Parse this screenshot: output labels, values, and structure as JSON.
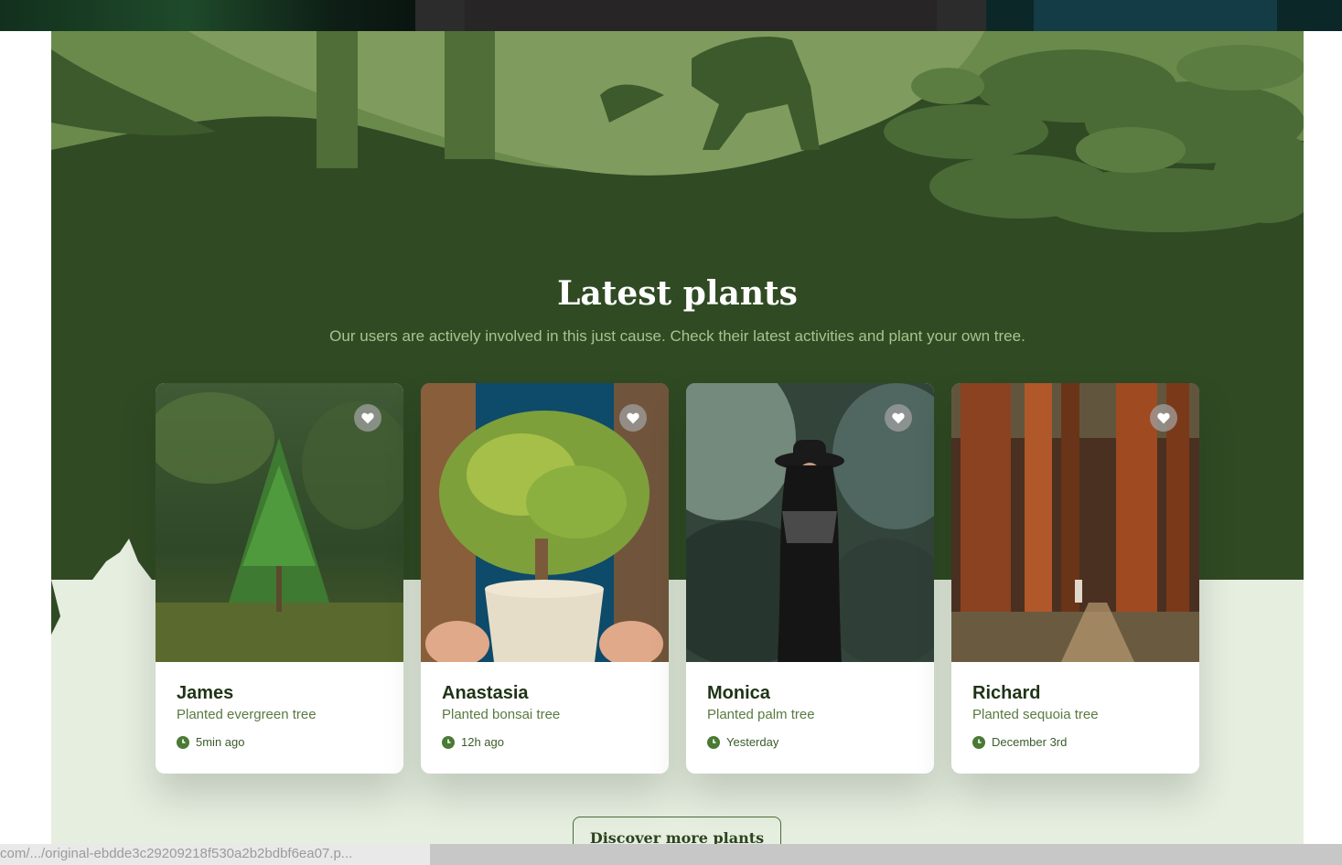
{
  "section": {
    "title": "Latest plants",
    "subtitle": "Our users are actively involved in this just cause. Check their latest activities and plant your own tree."
  },
  "cards": [
    {
      "name": "James",
      "description": "Planted evergreen tree",
      "time": "5min ago",
      "image": "evergreen-photo"
    },
    {
      "name": "Anastasia",
      "description": "Planted bonsai tree",
      "time": "12h ago",
      "image": "bonsai-photo"
    },
    {
      "name": "Monica",
      "description": "Planted palm tree",
      "time": "Yesterday",
      "image": "palm-photo"
    },
    {
      "name": "Richard",
      "description": "Planted sequoia tree",
      "time": "December 3rd",
      "image": "sequoia-photo"
    }
  ],
  "discover_button": "Discover more plants",
  "status_bar": {
    "url": "com/.../original-ebdde3c29209218f530a2b2bdbf6ea07.p..."
  },
  "icons": {
    "like": "heart-icon",
    "time": "clock-icon"
  },
  "colors": {
    "forest": "#304a24",
    "light_band": "#e6eee0",
    "accent_text": "#a8c48c",
    "card_name": "#1f3316"
  }
}
